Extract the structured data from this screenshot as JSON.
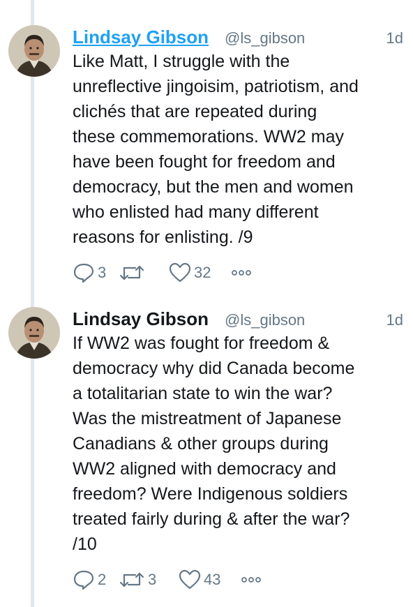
{
  "tweets": [
    {
      "author_name": "Lindsay Gibson",
      "handle": "@ls_gibson",
      "time": "1d",
      "text_lines": [
        "Like Matt, I struggle with the",
        "unreflective jingoisim, patriotism, and",
        "clichés that are repeated during",
        "these commemorations. WW2 may",
        "have been fought for freedom and",
        "democracy, but the men and women",
        "who enlisted had many different",
        "reasons for enlisting. /9"
      ],
      "replies": "3",
      "retweets": "",
      "likes": "32"
    },
    {
      "author_name": "Lindsay Gibson",
      "handle": "@ls_gibson",
      "time": "1d",
      "text_lines": [
        "If WW2 was fought for freedom &",
        "democracy why did Canada become",
        "a totalitarian state to win the war?",
        "Was the mistreatment of Japanese",
        "Canadians & other groups during",
        "WW2 aligned with democracy and",
        "freedom? Were Indigenous soldiers",
        "treated fairly during & after the war?",
        "/10"
      ],
      "replies": "2",
      "retweets": "3",
      "likes": "43"
    }
  ],
  "icons": {
    "reply": "reply-icon",
    "retweet": "retweet-icon",
    "like": "heart-icon",
    "more": "more-icon"
  },
  "colors": {
    "link": "#1da1f2",
    "muted": "#657786",
    "text": "#14171a",
    "thread_line": "#e1e8ed"
  }
}
